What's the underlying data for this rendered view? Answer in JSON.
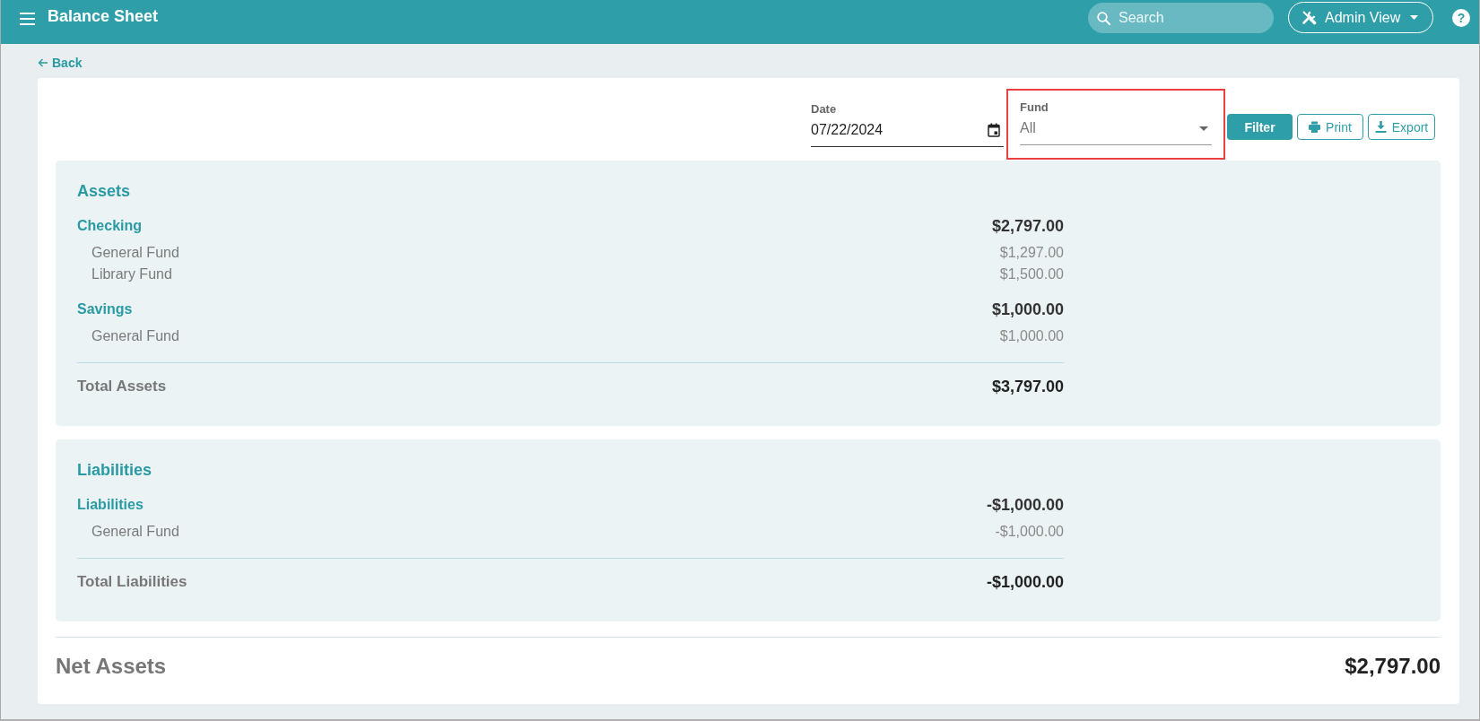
{
  "header": {
    "title": "Balance Sheet",
    "search": {
      "placeholder": "Search"
    },
    "view_menu": {
      "label": "Admin View"
    },
    "help": {
      "label": "?"
    }
  },
  "back_link": {
    "label": "Back"
  },
  "filters": {
    "fields": [
      {
        "kind": "date",
        "label": "Date",
        "value": "07/22/2024",
        "highlighted": false
      },
      {
        "kind": "select",
        "label": "Fund",
        "value": "All",
        "highlighted": true
      }
    ],
    "buttons": [
      {
        "kind": "filter",
        "label": "Filter"
      },
      {
        "kind": "print",
        "label": "Print"
      },
      {
        "kind": "export",
        "label": "Export"
      }
    ]
  },
  "sections": [
    {
      "title": "Assets",
      "groups": [
        {
          "name": "Checking",
          "amount": "$2,797.00",
          "funds": [
            {
              "name": "General Fund",
              "amount": "$1,297.00"
            },
            {
              "name": "Library Fund",
              "amount": "$1,500.00"
            }
          ]
        },
        {
          "name": "Savings",
          "amount": "$1,000.00",
          "funds": [
            {
              "name": "General Fund",
              "amount": "$1,000.00"
            }
          ]
        }
      ],
      "total": {
        "label": "Total Assets",
        "amount": "$3,797.00"
      }
    },
    {
      "title": "Liabilities",
      "groups": [
        {
          "name": "Liabilities",
          "amount": "-$1,000.00",
          "funds": [
            {
              "name": "General Fund",
              "amount": "-$1,000.00"
            }
          ]
        }
      ],
      "total": {
        "label": "Total Liabilities",
        "amount": "-$1,000.00"
      }
    }
  ],
  "net_assets": {
    "label": "Net Assets",
    "amount": "$2,797.00"
  }
}
